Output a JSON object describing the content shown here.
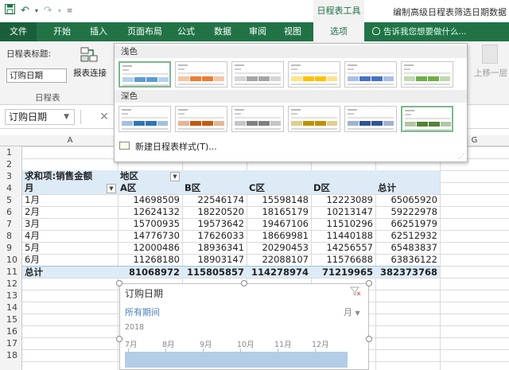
{
  "qat": {
    "save_icon": "save-icon",
    "undo_icon": "undo-icon",
    "redo_icon": "redo-icon",
    "customize_icon": "customize-qat-icon"
  },
  "context_tab_header": "日程表工具",
  "doc_title": "编制高级日程表筛选日期数据",
  "tabs": [
    "文件",
    "开始",
    "插入",
    "页面布局",
    "公式",
    "数据",
    "审阅",
    "视图",
    "选项"
  ],
  "active_tab": "选项",
  "tell_me": "告诉我您想要做什么...",
  "ribbon": {
    "caption_label": "日程表标题:",
    "caption_value": "订购日期",
    "report_connections": "报表连接",
    "group_name": "日程表",
    "move_up": "上移一层"
  },
  "formula_bar": {
    "name_box": "订购日期",
    "cancel_symbol": "✕"
  },
  "gallery": {
    "light_label": "浅色",
    "dark_label": "深色",
    "new_style": "新建日程表样式(T)...",
    "light_colors": [
      "#5b9bd5",
      "#ed7d31",
      "#a5a5a5",
      "#ffc000",
      "#4472c4",
      "#70ad47"
    ],
    "dark_colors": [
      "#2e75b6",
      "#c55a11",
      "#7f7f7f",
      "#bf9000",
      "#2f5597",
      "#548235"
    ],
    "selected_light": 0,
    "selected_dark": 5
  },
  "columns": [
    "A",
    "G"
  ],
  "rows": [
    "1",
    "2",
    "3",
    "4",
    "5",
    "6",
    "7",
    "8",
    "9",
    "10",
    "11",
    "12",
    "13",
    "14",
    "15",
    "16",
    "17",
    "18"
  ],
  "pivot": {
    "values_label": "求和项:销售金额",
    "col_field": "地区",
    "row_field": "月",
    "col_headers": [
      "A区",
      "B区",
      "C区",
      "D区",
      "总计"
    ],
    "data": [
      {
        "month": "1月",
        "vals": [
          "14698509",
          "22546174",
          "15598148",
          "12223089",
          "65065920"
        ]
      },
      {
        "month": "2月",
        "vals": [
          "12624132",
          "18220520",
          "18165179",
          "10213147",
          "59222978"
        ]
      },
      {
        "month": "3月",
        "vals": [
          "15700935",
          "19573642",
          "19467106",
          "11510296",
          "66251979"
        ]
      },
      {
        "month": "4月",
        "vals": [
          "14776730",
          "17626033",
          "18669981",
          "11440188",
          "62512932"
        ]
      },
      {
        "month": "5月",
        "vals": [
          "12000486",
          "18936341",
          "20290453",
          "14256557",
          "65483837"
        ]
      },
      {
        "month": "6月",
        "vals": [
          "11268180",
          "18903147",
          "22088107",
          "11576688",
          "63836122"
        ]
      }
    ],
    "total_label": "总计",
    "totals": [
      "81068972",
      "115805857",
      "114278974",
      "71219965",
      "382373768"
    ]
  },
  "timeline": {
    "title": "订购日期",
    "all_periods": "所有期间",
    "level": "月",
    "year": "2018",
    "months": [
      "7月",
      "8月",
      "9月",
      "10月",
      "11月",
      "12月"
    ]
  }
}
